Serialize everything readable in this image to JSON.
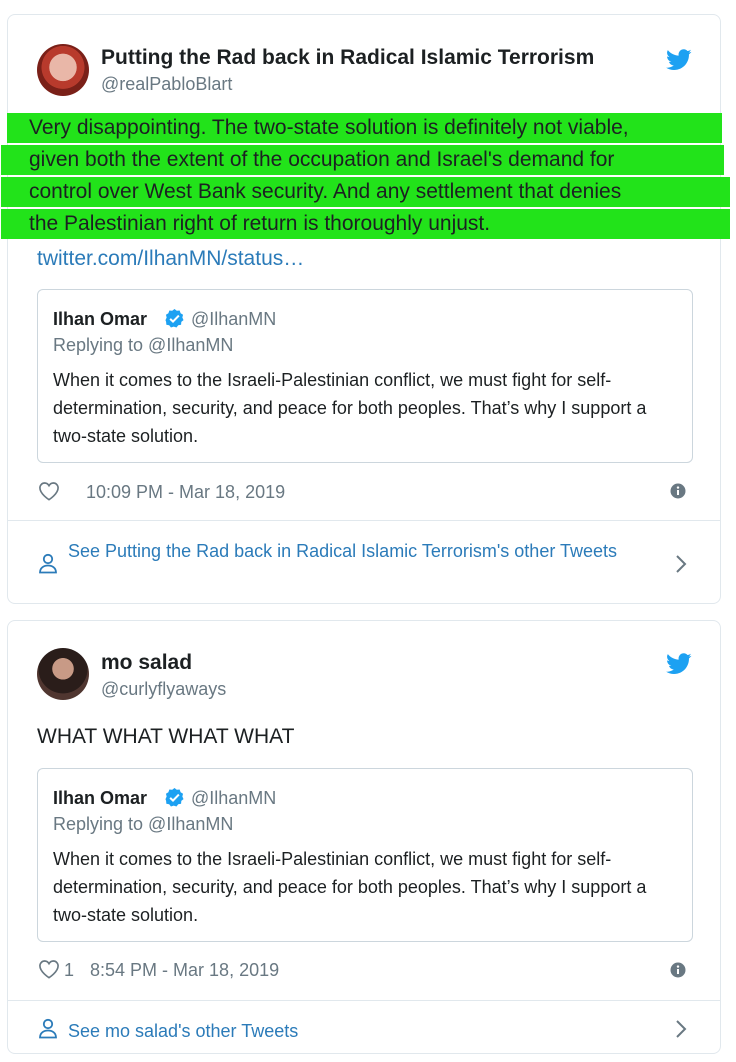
{
  "tweets": [
    {
      "author_name": "Putting the Rad back in Radical Islamic Terrorism",
      "author_handle": "@realPabloBlart",
      "text_lines": [
        "Very disappointing. The two-state solution is definitely not viable,",
        "given both the extent of the occupation and Israel's demand for",
        "control over West Bank security. And any settlement that denies",
        "the Palestinian right of return is thoroughly unjust."
      ],
      "link": "twitter.com/IlhanMN/status…",
      "highlight_color": "#22e31a",
      "quote": {
        "name": "Ilhan Omar",
        "handle": "@IlhanMN",
        "replying": "Replying to @IlhanMN",
        "body": "When it comes to the Israeli-Palestinian conflict, we must fight for self-determination, security, and peace for both peoples. That’s why I support a two-state solution."
      },
      "like_count": "",
      "timestamp": "10:09 PM - Mar 18, 2019",
      "see_more": "See Putting the Rad back in Radical Islamic Terrorism's other Tweets"
    },
    {
      "author_name": "mo salad",
      "author_handle": "@curlyflyaways",
      "text": "WHAT WHAT WHAT WHAT",
      "quote": {
        "name": "Ilhan Omar",
        "handle": "@IlhanMN",
        "replying": "Replying to @IlhanMN",
        "body": "When it comes to the Israeli-Palestinian conflict, we must fight for self-determination, security, and peace for both peoples. That’s why I support a two-state solution."
      },
      "like_count": "1",
      "timestamp": "8:54 PM - Mar 18, 2019",
      "see_more": "See mo salad's other Tweets"
    }
  ],
  "colors": {
    "link": "#2b7bb9",
    "twitter_blue": "#1da1f2",
    "secondary_text": "#697882",
    "border": "#e1e8ed"
  },
  "icons": [
    "twitter-bird-icon",
    "verified-badge-icon",
    "heart-icon",
    "info-icon",
    "person-icon",
    "chevron-right-icon"
  ]
}
